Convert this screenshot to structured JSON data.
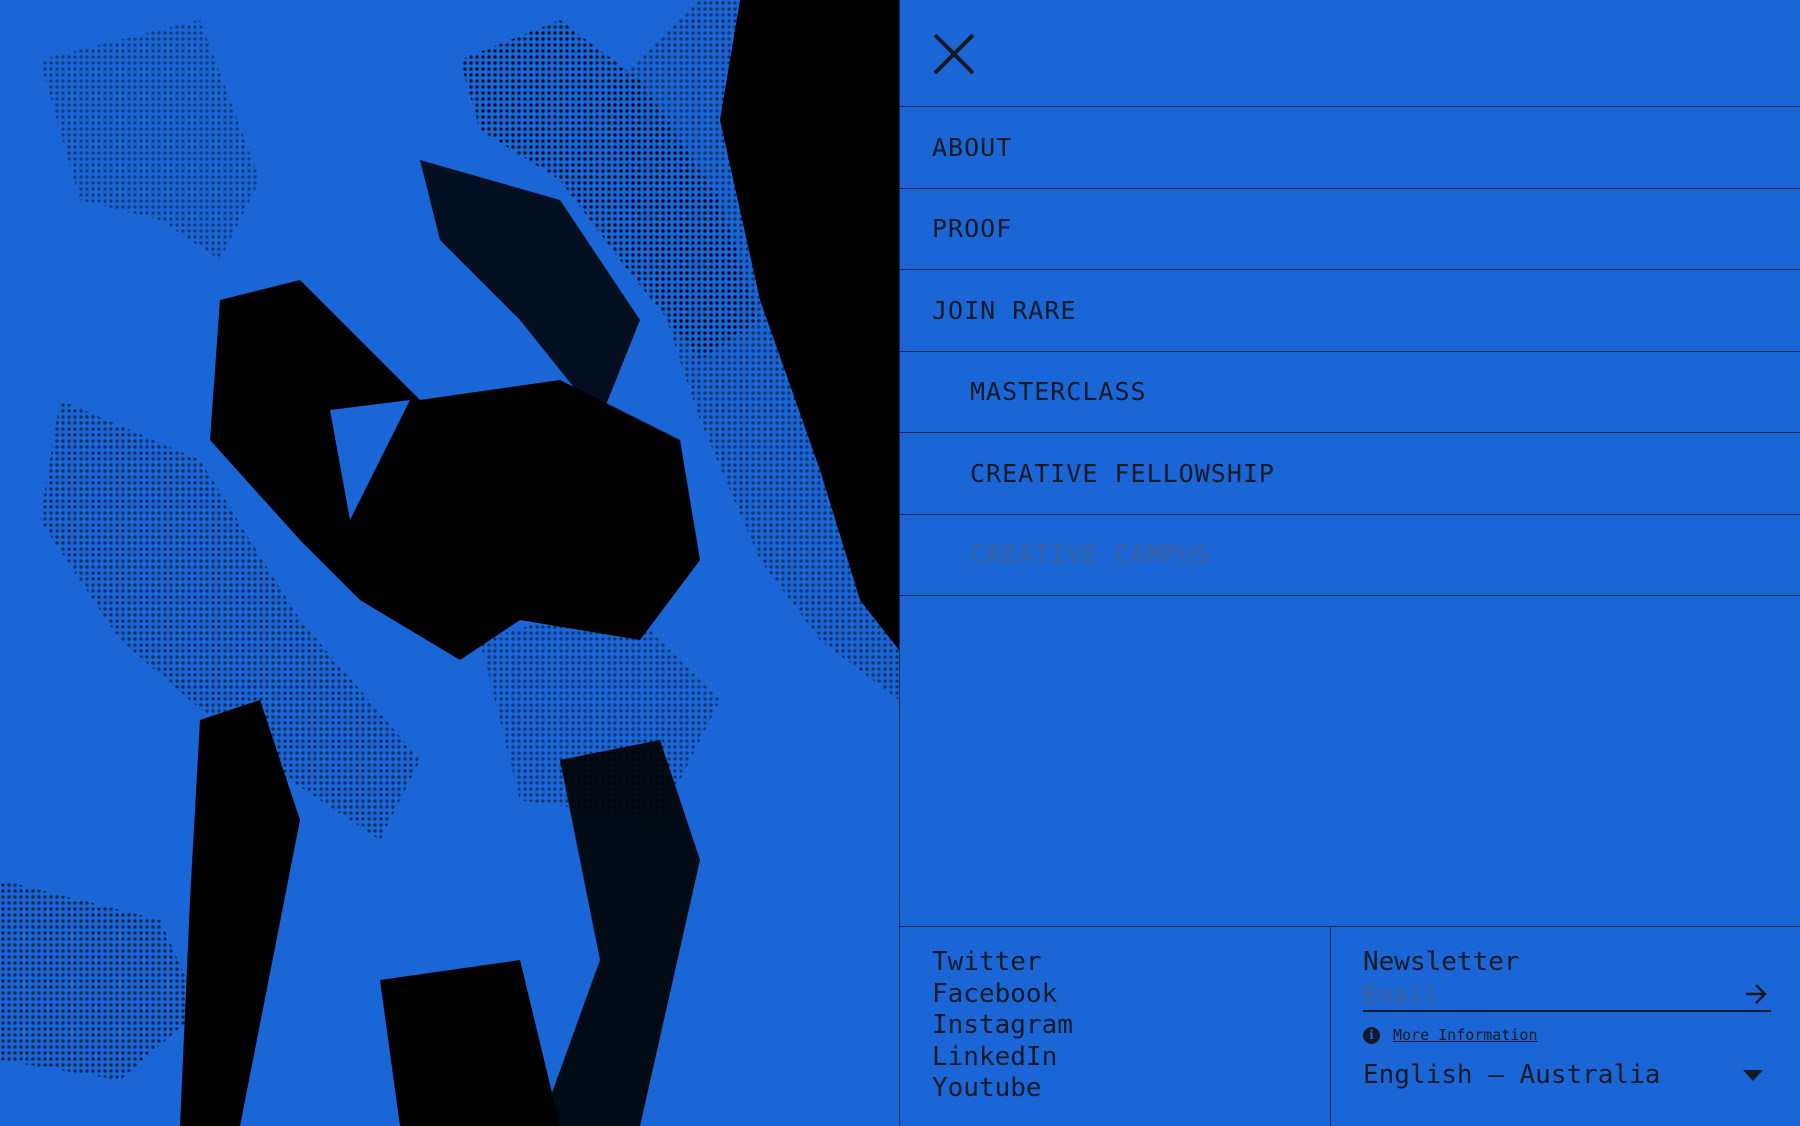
{
  "close_button": {
    "icon": "close-icon"
  },
  "nav": {
    "items": [
      {
        "label": "ABOUT",
        "level": 0,
        "muted": false
      },
      {
        "label": "PROOF",
        "level": 0,
        "muted": false
      },
      {
        "label": "JOIN RARE",
        "level": 0,
        "muted": false
      },
      {
        "label": "MASTERCLASS",
        "level": 1,
        "muted": false
      },
      {
        "label": "CREATIVE FELLOWSHIP",
        "level": 1,
        "muted": false
      },
      {
        "label": "CREATIVE CAMPUS",
        "level": 1,
        "muted": true
      }
    ]
  },
  "social": {
    "links": [
      "Twitter",
      "Facebook",
      "Instagram",
      "LinkedIn",
      "Youtube"
    ]
  },
  "newsletter": {
    "title": "Newsletter",
    "email_placeholder": "Email",
    "email_value": "",
    "more_info_label": "More Information"
  },
  "language": {
    "selected": "English — Australia"
  },
  "colors": {
    "brand_blue": "#1a66d6",
    "ink": "#131a26",
    "muted": "#3d5f97"
  }
}
